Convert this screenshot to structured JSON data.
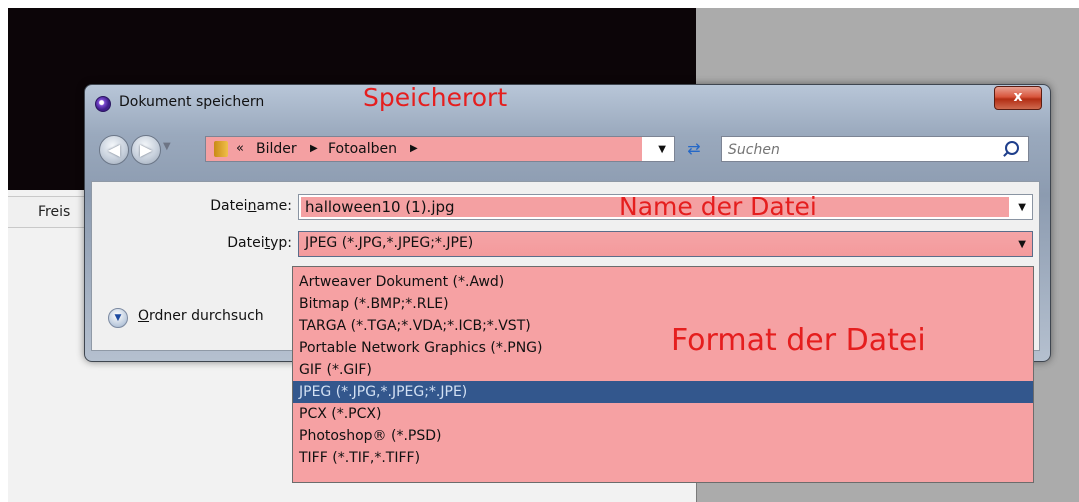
{
  "background": {
    "status_text": "Freis"
  },
  "dialog": {
    "title": "Dokument speichern",
    "title_annotation": "Speicherort",
    "close_symbol": "x",
    "address": {
      "chevron": "«",
      "crumbs": [
        "Bilder",
        "Fotoalben"
      ]
    },
    "search_placeholder": "Suchen",
    "filename": {
      "label_pre": "Datei",
      "label_underline": "n",
      "label_post": "ame:",
      "value": "halloween10 (1).jpg",
      "annotation": "Name der Datei"
    },
    "filetype": {
      "label_pre": "Datei",
      "label_underline": "t",
      "label_post": "yp:",
      "value": "JPEG (*.JPG,*.JPEG;*.JPE)"
    },
    "browse": {
      "label_underline": "O",
      "label_post": "rdner durchsuch"
    }
  },
  "dropdown": {
    "annotation": "Format der Datei",
    "selected_index": 5,
    "options": [
      "Artweaver Dokument (*.Awd)",
      "Bitmap (*.BMP;*.RLE)",
      "TARGA (*.TGA;*.VDA;*.ICB;*.VST)",
      "Portable Network Graphics (*.PNG)",
      "GIF (*.GIF)",
      "JPEG (*.JPG,*.JPEG;*.JPE)",
      "PCX (*.PCX)",
      "Photoshop® (*.PSD)",
      "TIFF (*.TIF,*.TIFF)"
    ]
  },
  "colors": {
    "annotation_red": "#e51e1e",
    "highlight_pink": "#f4a0a2",
    "selection_blue": "#33578d"
  },
  "icons": [
    "app-icon",
    "close-icon",
    "back-arrow-icon",
    "forward-arrow-icon",
    "folder-icon",
    "refresh-icon",
    "search-icon",
    "expand-chevron-icon",
    "dropdown-arrow-icon"
  ]
}
